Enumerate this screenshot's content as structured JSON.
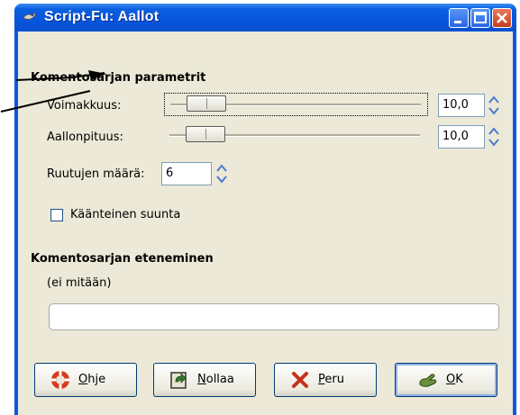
{
  "window": {
    "title": "Script-Fu: Aallot"
  },
  "parameters": {
    "heading": "Komentosarjan parametrit",
    "strength_label": "Voimakkuus:",
    "strength_value": "10,0",
    "wavelength_label": "Aallonpituus:",
    "wavelength_value": "10,0",
    "tiles_label": "Ruutujen määrä:",
    "tiles_value": "6",
    "reverse_label": "Käänteinen suunta",
    "reverse_checked": false
  },
  "progress": {
    "heading": "Komentosarjan eteneminen",
    "status": "(ei mitään)"
  },
  "buttons": {
    "help_u": "O",
    "help_rest": "hje",
    "reset_u": "N",
    "reset_rest": "ollaa",
    "cancel_u": "P",
    "cancel_rest": "eru",
    "ok_u": "O",
    "ok_rest": "K"
  },
  "icons": [
    "script-fu-icon",
    "minimize-icon",
    "maximize-icon",
    "close-icon",
    "lifebuoy-icon",
    "reset-icon",
    "cancel-x-icon",
    "ok-hand-icon",
    "pointer-arrow"
  ]
}
